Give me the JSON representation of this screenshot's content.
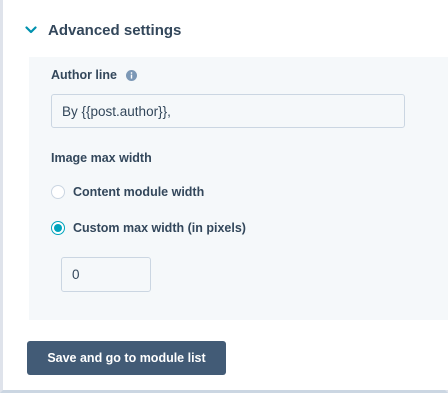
{
  "section": {
    "title": "Advanced settings",
    "expanded": true,
    "icon": "chevron-down-icon"
  },
  "author_line": {
    "label": "Author line",
    "info_icon": "info-icon",
    "value": "By {{post.author}},"
  },
  "image_max_width": {
    "label": "Image max width",
    "options": [
      {
        "label": "Content module width",
        "selected": false
      },
      {
        "label": "Custom max width (in pixels)",
        "selected": true
      }
    ],
    "custom_width_value": "0"
  },
  "footer": {
    "save_label": "Save and go to module list"
  },
  "colors": {
    "accent": "#00a4bd",
    "button": "#425b76",
    "text": "#33475b",
    "panel_background": "#f5f8fa"
  }
}
